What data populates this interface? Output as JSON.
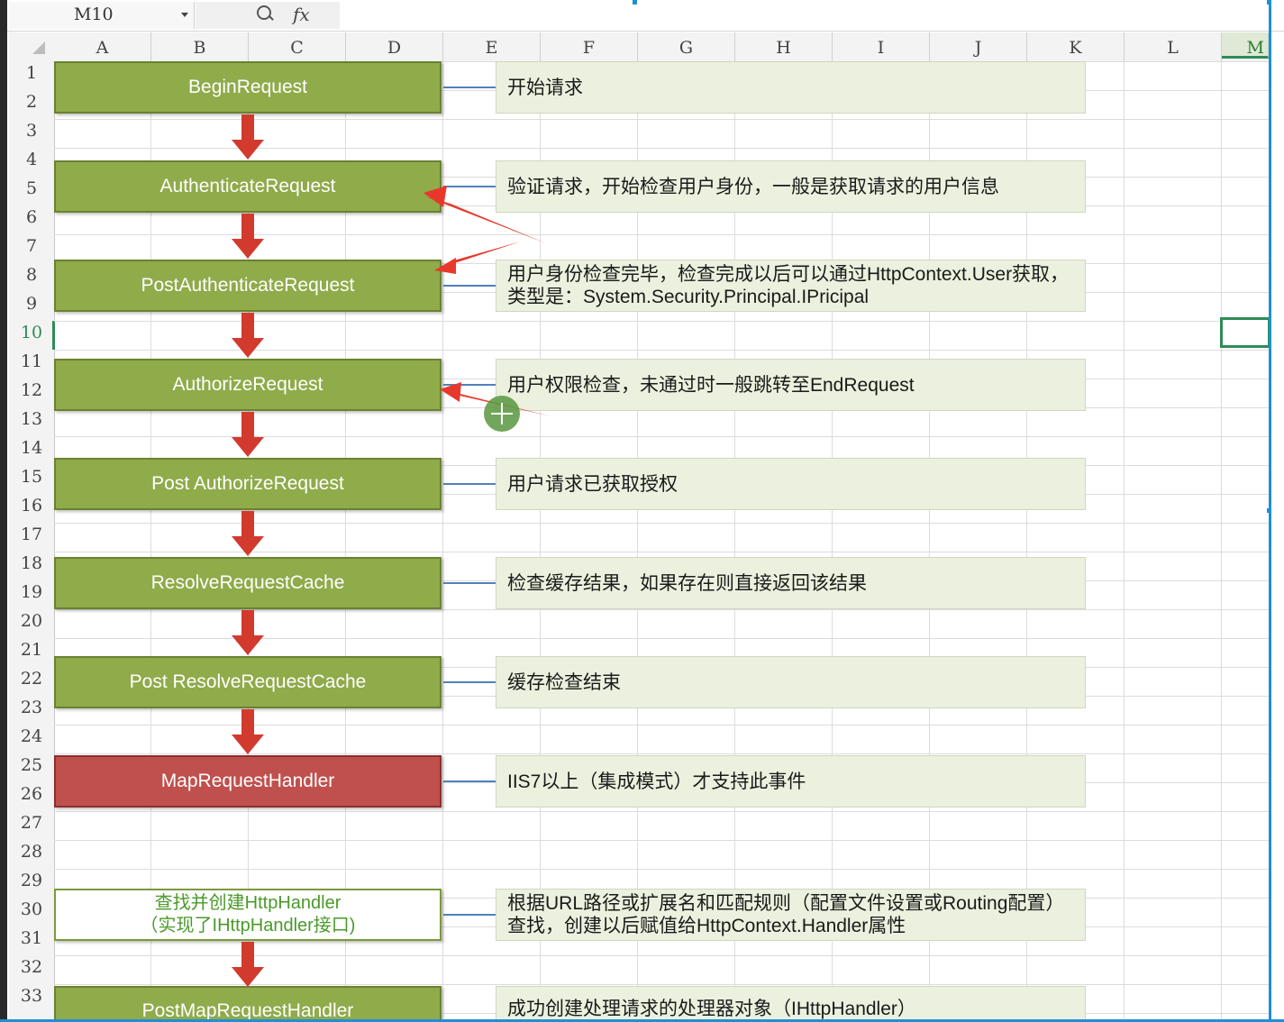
{
  "formula_bar": {
    "cell_ref": "M10",
    "fx_label": "fx",
    "formula_value": ""
  },
  "column_headers": [
    "A",
    "B",
    "C",
    "D",
    "E",
    "F",
    "G",
    "H",
    "I",
    "J",
    "K",
    "L",
    "M"
  ],
  "row_headers": [
    "1",
    "2",
    "3",
    "4",
    "5",
    "6",
    "7",
    "8",
    "9",
    "10",
    "11",
    "12",
    "13",
    "14",
    "15",
    "16",
    "17",
    "18",
    "19",
    "20",
    "21",
    "22",
    "23",
    "24",
    "25",
    "26",
    "27",
    "28",
    "29",
    "30",
    "31",
    "32",
    "33"
  ],
  "selected_cell": {
    "column": "M",
    "row": "10"
  },
  "steps": [
    {
      "label": "BeginRequest",
      "note": [
        "开始请求"
      ]
    },
    {
      "label": "AuthenticateRequest",
      "note": [
        "验证请求，开始检查用户身份，一般是获取请求的用户信息"
      ]
    },
    {
      "label": "PostAuthenticateRequest",
      "note": [
        "用户身份检查完毕，检查完成以后可以通过HttpContext.User获取，",
        "类型是：System.Security.Principal.IPricipal"
      ]
    },
    {
      "label": "AuthorizeRequest",
      "note": [
        "用户权限检查，未通过时一般跳转至EndRequest"
      ]
    },
    {
      "label": "Post AuthorizeRequest",
      "note": [
        "用户请求已获取授权"
      ]
    },
    {
      "label": "ResolveRequestCache",
      "note": [
        "检查缓存结果，如果存在则直接返回该结果"
      ]
    },
    {
      "label": "Post ResolveRequestCache",
      "note": [
        "缓存检查结束"
      ]
    },
    {
      "label": "MapRequestHandler",
      "note": [
        "IIS7以上（集成模式）才支持此事件"
      ]
    },
    {
      "label_lines": [
        "查找并创建HttpHandler",
        "（实现了IHttpHandler接口)"
      ],
      "note": [
        "根据URL路径或扩展名和匹配规则（配置文件设置或Routing配置）",
        "查找，创建以后赋值给HttpContext.Handler属性"
      ]
    },
    {
      "label": "PostMapRequestHandler",
      "note": [
        "成功创建处理请求的处理器对象（IHttpHandler）"
      ]
    }
  ],
  "colors": {
    "step_green": "#8fab4a",
    "step_red": "#c0504d",
    "note_bg": "#ebf1de",
    "arrow_red": "#d23a2e",
    "connector_blue": "#4f81bd",
    "selection_green": "#2e8b57"
  }
}
